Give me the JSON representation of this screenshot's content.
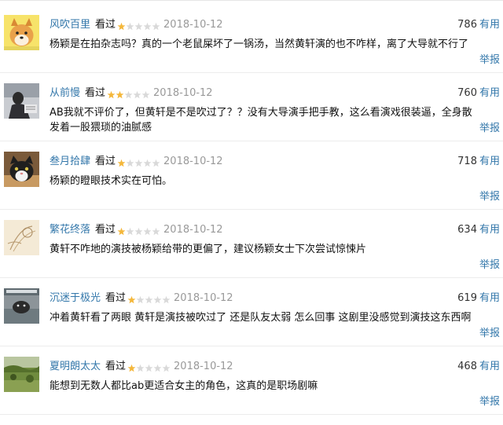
{
  "comments": [
    {
      "user": "风吹百里",
      "status": "看过",
      "rating": 1,
      "max_rating": 5,
      "date": "2018-10-12",
      "votes": "786",
      "useful_label": "有用",
      "text": "杨颖是在拍杂志吗？真的一个老鼠屎坏了一锅汤，当然黄轩演的也不咋样，离了大导就不行了",
      "report_label": "举报",
      "avatar_icon": "shiba-dog-avatar"
    },
    {
      "user": "从前慢",
      "status": "看过",
      "rating": 2,
      "max_rating": 5,
      "date": "2018-10-12",
      "votes": "760",
      "useful_label": "有用",
      "text": "AB我就不评价了，但黄轩是不是吹过了？？没有大导演手把手教，这么看演戏很装逼，全身散发着一股猥琐的油腻感",
      "report_label": "举报",
      "avatar_icon": "person-photo-avatar"
    },
    {
      "user": "叁月拾肆",
      "status": "看过",
      "rating": 1,
      "max_rating": 5,
      "date": "2018-10-12",
      "votes": "718",
      "useful_label": "有用",
      "text": "杨颖的瞪眼技术实在可怕。",
      "report_label": "举报",
      "avatar_icon": "cat-avatar"
    },
    {
      "user": "繁花终落",
      "status": "看过",
      "rating": 1,
      "max_rating": 5,
      "date": "2018-10-12",
      "votes": "634",
      "useful_label": "有用",
      "text": "黄轩不咋地的演技被杨颖给带的更偏了，建议杨颖女士下次尝试惊悚片",
      "report_label": "举报",
      "avatar_icon": "sketch-art-avatar"
    },
    {
      "user": "沉迷于极光",
      "status": "看过",
      "rating": 1,
      "max_rating": 5,
      "date": "2018-10-12",
      "votes": "619",
      "useful_label": "有用",
      "text": "冲着黄轩看了两眼 黄轩是演技被吹过了 还是队友太弱 怎么回事 这剧里没感觉到演技这东西啊",
      "report_label": "举报",
      "avatar_icon": "dog-water-avatar"
    },
    {
      "user": "夏明朗太太",
      "status": "看过",
      "rating": 1,
      "max_rating": 5,
      "date": "2018-10-12",
      "votes": "468",
      "useful_label": "有用",
      "text": "能想到无数人都比ab更适合女主的角色，这真的是职场剧嘛",
      "report_label": "举报",
      "avatar_icon": "landscape-avatar"
    }
  ],
  "colors": {
    "link": "#3377aa",
    "star_on": "#f4b73a",
    "star_off": "#d9d9d9",
    "date": "#999999"
  }
}
